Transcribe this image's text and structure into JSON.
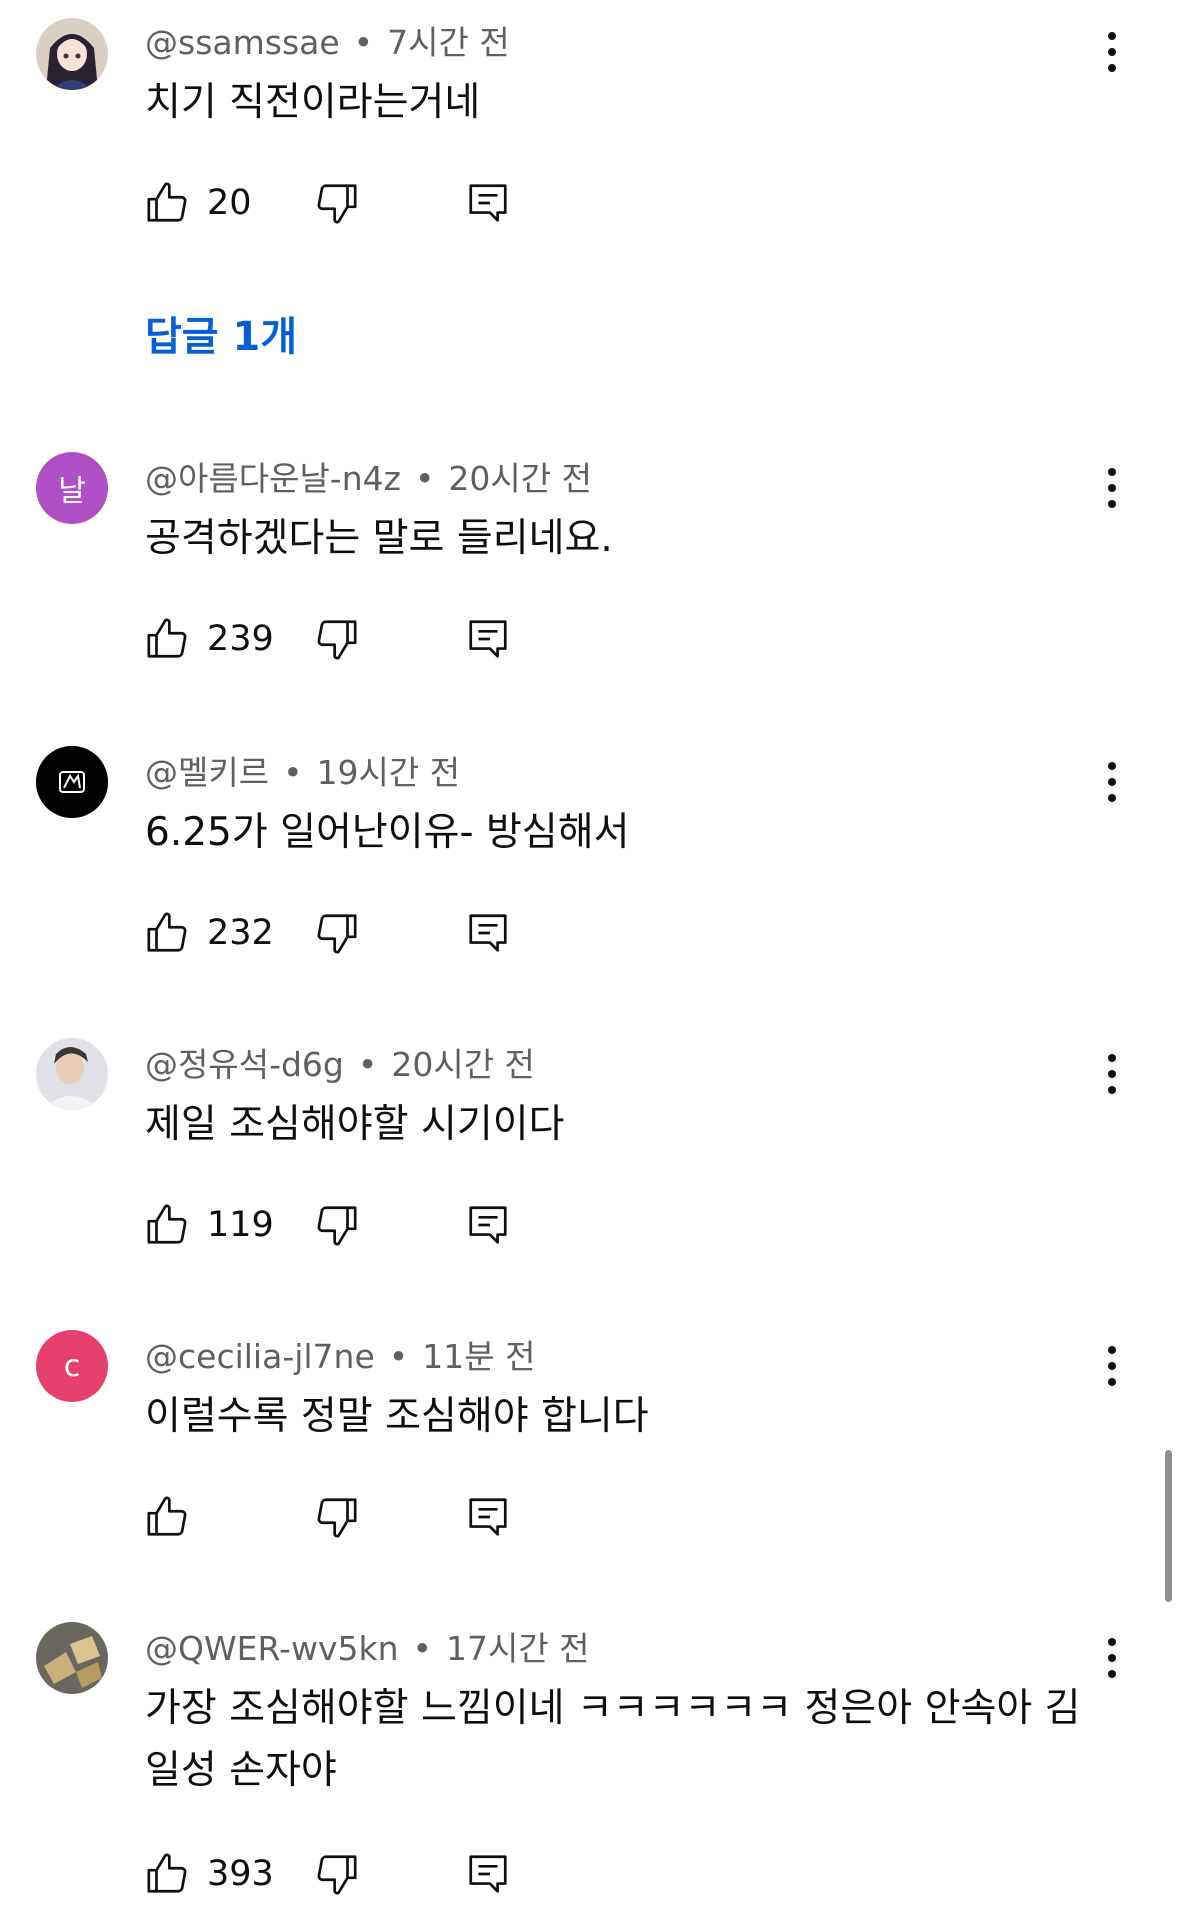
{
  "comments": [
    {
      "author": "@ssamssae",
      "time": "7시간 전",
      "text": "치기 직전이라는거네",
      "likes": "20",
      "avatar": "anime-girl-avatar"
    },
    {
      "author": "@아름다운날-n4z",
      "time": "20시간 전",
      "text": "공격하겠다는 말로 들리네요.",
      "likes": "239",
      "avatar_letter": "날",
      "avatar_color": "#b04fc6"
    },
    {
      "author": "@멜키르",
      "time": "19시간 전",
      "text": "6.25가 일어난이유- 방심해서",
      "likes": "232",
      "avatar": "black-logo-avatar"
    },
    {
      "author": "@정유석-d6g",
      "time": "20시간 전",
      "text": "제일 조심해야할 시기이다",
      "likes": "119",
      "avatar": "person-photo-avatar"
    },
    {
      "author": "@cecilia-jl7ne",
      "time": "11분 전",
      "text": "이럴수록 정말 조심해야 합니다",
      "likes": "",
      "avatar_letter": "c",
      "avatar_color": "#e8406d"
    },
    {
      "author": "@QWER-wv5kn",
      "time": "17시간 전",
      "text": "가장 조심해야할 느낌이네 ㅋㅋㅋㅋㅋㅋ 정은아 안속아 김일성 손자야",
      "likes": "393",
      "avatar": "gold-bars-avatar"
    }
  ],
  "replies_link": "답글 1개",
  "meta_separator": "•",
  "colors": {
    "link": "#065fd4",
    "meta": "#606060",
    "text": "#0f0f0f"
  }
}
